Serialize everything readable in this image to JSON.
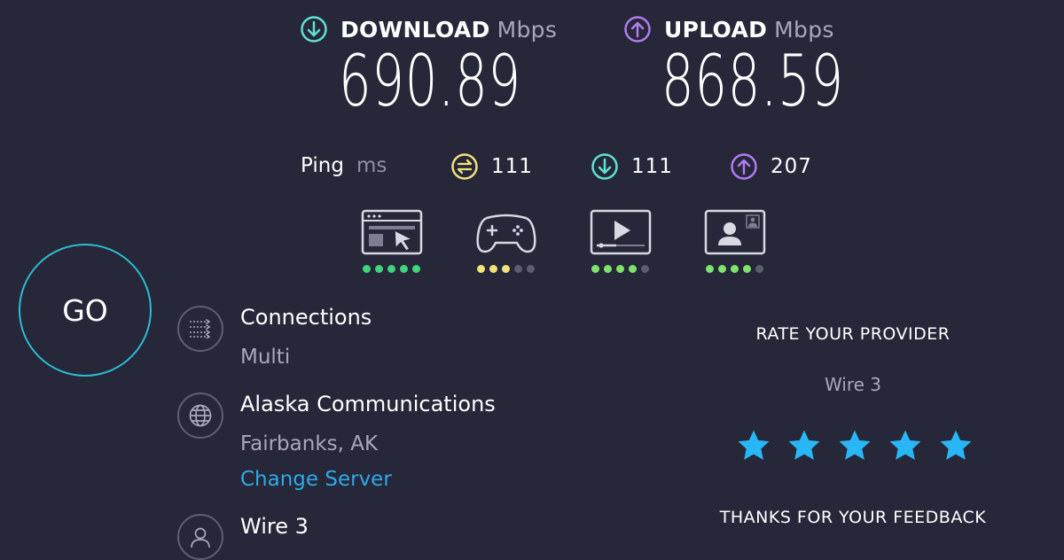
{
  "download": {
    "label": "DOWNLOAD",
    "unit": "Mbps",
    "value": "690.89",
    "icon": "arrow-down-circle-icon",
    "color": "#5fe1d3"
  },
  "upload": {
    "label": "UPLOAD",
    "unit": "Mbps",
    "value": "868.59",
    "icon": "arrow-up-circle-icon",
    "color": "#b07cf2"
  },
  "ping": {
    "label": "Ping",
    "unit": "ms",
    "idle": "111",
    "download": "111",
    "upload": "207",
    "colors": {
      "idle": "#f2e27a",
      "download": "#5fe1d3",
      "upload": "#b07cf2"
    }
  },
  "quality": [
    {
      "name": "browsing",
      "icon": "browser-cursor-icon",
      "level": 5,
      "color": "#3fd47a"
    },
    {
      "name": "gaming",
      "icon": "gamepad-icon",
      "level": 3,
      "color": "#f2e27a"
    },
    {
      "name": "streaming",
      "icon": "video-play-icon",
      "level": 4,
      "color": "#7ee36a"
    },
    {
      "name": "video-calls",
      "icon": "video-call-icon",
      "level": 4,
      "color": "#7ee36a"
    }
  ],
  "go_label": "GO",
  "connections": {
    "title": "Connections",
    "value": "Multi",
    "icon": "connections-icon"
  },
  "server": {
    "title": "Alaska Communications",
    "location": "Fairbanks, AK",
    "change_link": "Change Server",
    "icon": "globe-icon"
  },
  "provider": {
    "title": "Wire 3",
    "icon": "user-icon"
  },
  "rating": {
    "heading": "RATE YOUR PROVIDER",
    "provider": "Wire 3",
    "stars": 5,
    "star_color": "#29b6f6",
    "thanks": "THANKS FOR YOUR FEEDBACK"
  }
}
